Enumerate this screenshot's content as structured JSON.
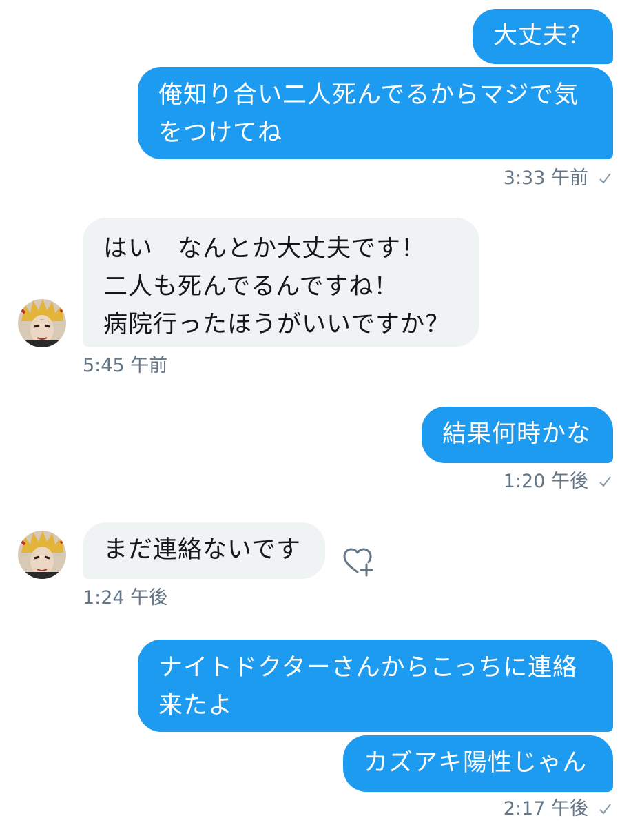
{
  "colors": {
    "outgoing_bubble": "#1d9bf0",
    "incoming_bubble": "#eff3f4",
    "timestamp": "#657786"
  },
  "messages": {
    "m1": {
      "text": "大丈夫？"
    },
    "m2": {
      "text": "俺知り合い二人死んでるからマジで気\nをつけてね",
      "time": "3:33 午前"
    },
    "m3": {
      "text": "はい　なんとか大丈夫です！\n二人も死んでるんですね！\n病院行ったほうがいいですか？",
      "time": "5:45 午前"
    },
    "m4": {
      "text": "結果何時かな",
      "time": "1:20 午後"
    },
    "m5": {
      "text": "まだ連絡ないです",
      "time": "1:24 午後"
    },
    "m6": {
      "text": "ナイトドクターさんからこっちに連絡\n来たよ"
    },
    "m7": {
      "text": "カズアキ陽性じゃん",
      "time": "2:17 午後"
    }
  },
  "icons": {
    "sent_status": "checkmark-icon",
    "reaction": "heart-plus-icon",
    "contact": "avatar"
  }
}
